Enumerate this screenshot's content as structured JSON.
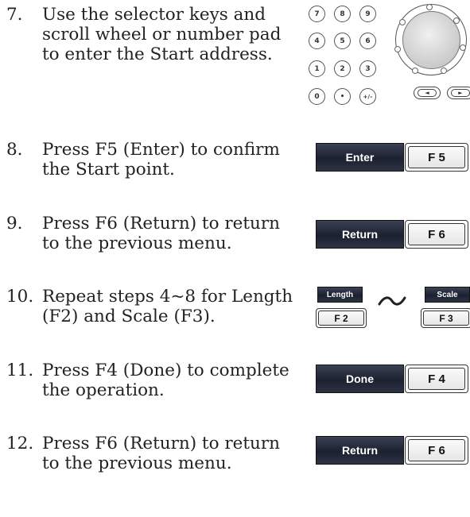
{
  "steps": [
    {
      "num": "7.",
      "lines": [
        "Use the selector keys and",
        "scroll wheel or number pad",
        "to enter the Start address."
      ]
    },
    {
      "num": "8.",
      "lines": [
        "Press F5 (Enter) to confirm",
        "the Start point."
      ]
    },
    {
      "num": "9.",
      "lines": [
        "Press F6 (Return) to return",
        "to the previous menu."
      ]
    },
    {
      "num": "10.",
      "lines": [
        "Repeat steps 4~8 for Length",
        "(F2) and Scale (F3)."
      ]
    },
    {
      "num": "11.",
      "lines": [
        "Press F4 (Done) to complete",
        "the operation."
      ]
    },
    {
      "num": "12.",
      "lines": [
        "Press F6 (Return) to return",
        "to the previous menu."
      ]
    }
  ],
  "keypad": [
    "7",
    "8",
    "9",
    "4",
    "5",
    "6",
    "1",
    "2",
    "3",
    "0",
    "•",
    "+/–"
  ],
  "arrows": {
    "left": "◄",
    "right": "►"
  },
  "softkeys": {
    "enter": "Enter",
    "return1": "Return",
    "length": "Length",
    "scale": "Scale",
    "done": "Done",
    "return2": "Return"
  },
  "fkeys": {
    "f5": "F 5",
    "f6a": "F 6",
    "f2": "F 2",
    "f3": "F 3",
    "f4": "F 4",
    "f6b": "F 6"
  },
  "colors": {
    "softkey_bg": "#1c2130",
    "softkey_text": "#ffffff"
  }
}
